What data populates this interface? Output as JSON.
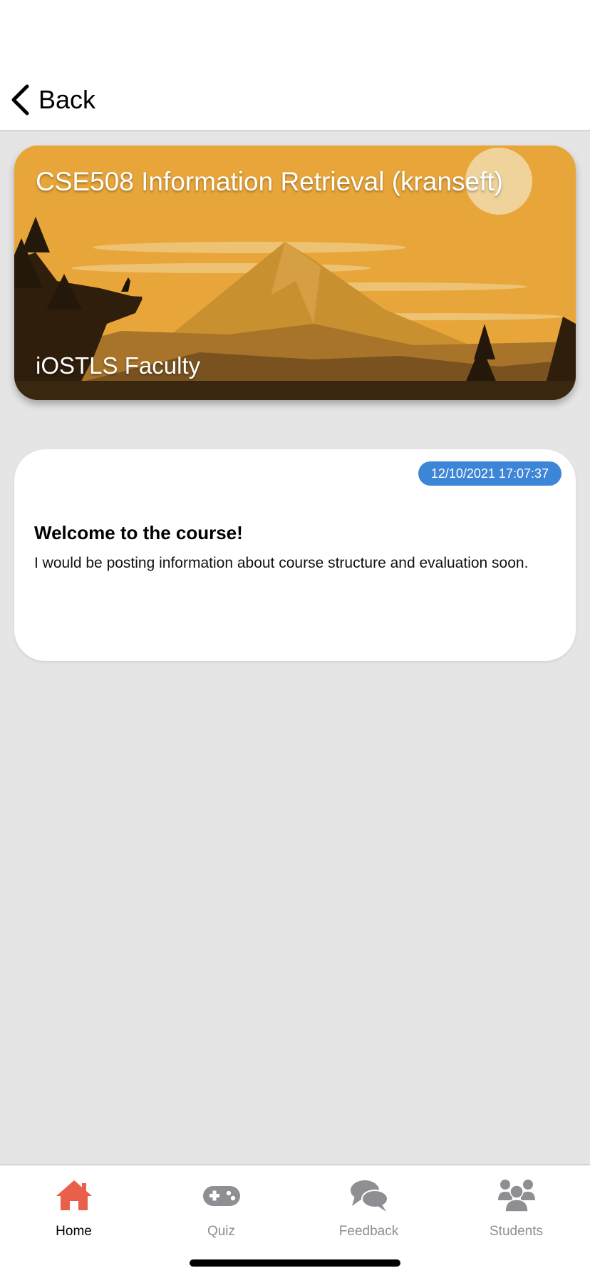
{
  "nav": {
    "back_label": "Back"
  },
  "course": {
    "title": "CSE508 Information Retrieval (kranseft)",
    "subtitle": "iOSTLS Faculty"
  },
  "post": {
    "timestamp": "12/10/2021 17:07:37",
    "title": "Welcome to the course!",
    "body": "I would be posting information about course structure and evaluation soon."
  },
  "tabs": [
    {
      "label": "Home",
      "icon": "home-icon",
      "active": true
    },
    {
      "label": "Quiz",
      "icon": "gamepad-icon",
      "active": false
    },
    {
      "label": "Feedback",
      "icon": "chat-bubbles-icon",
      "active": false
    },
    {
      "label": "Students",
      "icon": "users-icon",
      "active": false
    }
  ],
  "colors": {
    "active_tab": "#e8604a",
    "inactive_tab": "#8e8e93",
    "timestamp_badge": "#3d85d6",
    "banner_sky": "#e8a63a"
  }
}
